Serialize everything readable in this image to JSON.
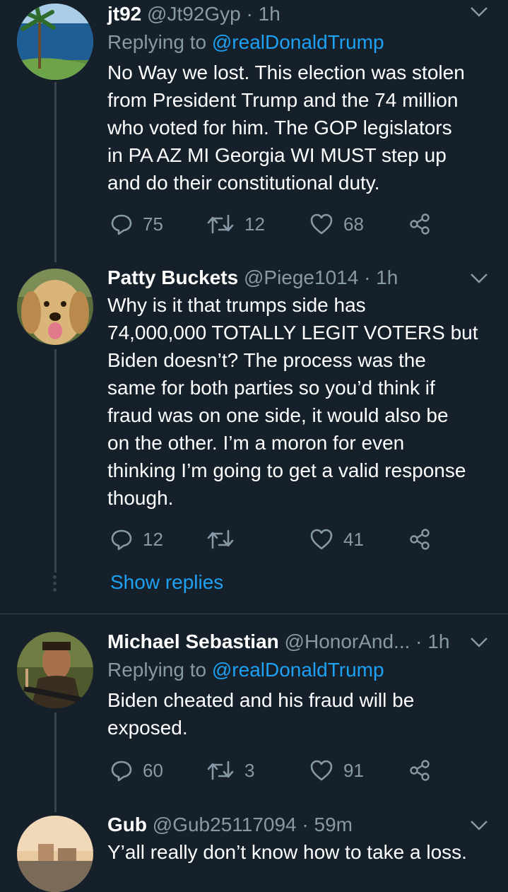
{
  "tweets": [
    {
      "name": "jt92",
      "handle": "@Jt92Gyp",
      "time": "· 1h",
      "replying_prefix": "Replying to",
      "replying_to": "@realDonaldTrump",
      "text": [
        "No Way we lost. This election was stolen",
        "from President Trump and the 74 million",
        "who voted for him. The GOP legislators",
        "in PA AZ MI Georgia WI MUST step up",
        "and do their constitutional duty."
      ],
      "replies": "75",
      "retweets": "12",
      "likes": "68"
    },
    {
      "name": "Patty Buckets",
      "handle": "@Piege1014",
      "time": "· 1h",
      "text": [
        "Why is it that trumps side has",
        "74,000,000 TOTALLY LEGIT VOTERS but",
        "Biden doesn’t? The process was the",
        "same for both parties so you’d think if",
        "fraud was on one side, it would also be",
        "on the other. I’m a moron for even",
        "thinking I’m going to get a valid response",
        "though."
      ],
      "replies": "12",
      "retweets": "",
      "likes": "41",
      "show_replies": "Show replies"
    },
    {
      "name": "Michael Sebastian",
      "handle": "@HonorAnd...",
      "time": "· 1h",
      "replying_prefix": "Replying to",
      "replying_to": "@realDonaldTrump",
      "text": [
        "Biden cheated and his fraud will be",
        "exposed."
      ],
      "replies": "60",
      "retweets": "3",
      "likes": "91"
    },
    {
      "name": "Gub",
      "handle": "@Gub25117094",
      "time": "· 59m",
      "text": [
        "Y’all really don’t know how to take a loss."
      ]
    }
  ],
  "icons": {
    "reply": "reply-icon",
    "retweet": "retweet-icon",
    "like": "heart-icon",
    "share": "share-icon",
    "more": "chevron-down-icon"
  },
  "colors": {
    "background": "#15202b",
    "text": "#ffffff",
    "muted": "#8899a6",
    "accent": "#1da1f2",
    "border": "#38444d"
  }
}
